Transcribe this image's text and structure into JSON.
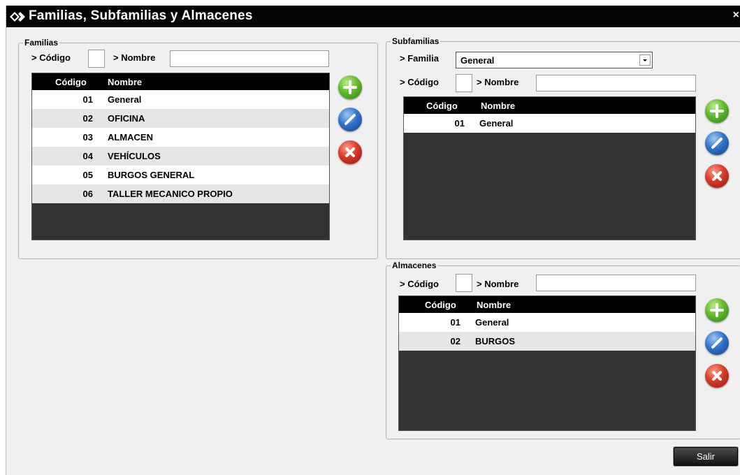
{
  "window": {
    "title": "Familias, Subfamilias y Almacenes",
    "close": "×"
  },
  "familias": {
    "legend": "Familias",
    "codigo_label": "> Código",
    "nombre_label": "> Nombre",
    "codigo_value": "",
    "nombre_value": "",
    "columns": [
      "Código",
      "Nombre"
    ],
    "rows": [
      {
        "codigo": "01",
        "nombre": "General"
      },
      {
        "codigo": "02",
        "nombre": "OFICINA"
      },
      {
        "codigo": "03",
        "nombre": "ALMACEN"
      },
      {
        "codigo": "04",
        "nombre": "VEHÍCULOS"
      },
      {
        "codigo": "05",
        "nombre": "BURGOS GENERAL"
      },
      {
        "codigo": "06",
        "nombre": "TALLER MECANICO PROPIO"
      }
    ]
  },
  "subfamilias": {
    "legend": "Subfamilias",
    "familia_label": "> Familia",
    "familia_selected": "General",
    "codigo_label": "> Código",
    "nombre_label": "> Nombre",
    "codigo_value": "",
    "nombre_value": "",
    "columns": [
      "Código",
      "Nombre"
    ],
    "rows": [
      {
        "codigo": "01",
        "nombre": "General"
      }
    ]
  },
  "almacenes": {
    "legend": "Almacenes",
    "codigo_label": "> Código",
    "nombre_label": "> Nombre",
    "codigo_value": "",
    "nombre_value": "",
    "columns": [
      "Código",
      "Nombre"
    ],
    "rows": [
      {
        "codigo": "01",
        "nombre": "General"
      },
      {
        "codigo": "02",
        "nombre": "BURGOS"
      }
    ]
  },
  "footer": {
    "salir_label": "Salir"
  },
  "icons": {
    "add": "plus-icon",
    "edit": "pencil-icon",
    "delete": "x-icon",
    "title": "diamond-arrows-icon"
  },
  "colors": {
    "titlebar": "#050505",
    "add": "#4caf24",
    "edit": "#2a65c2",
    "delete": "#d0321f",
    "grid_bg": "#333333"
  }
}
